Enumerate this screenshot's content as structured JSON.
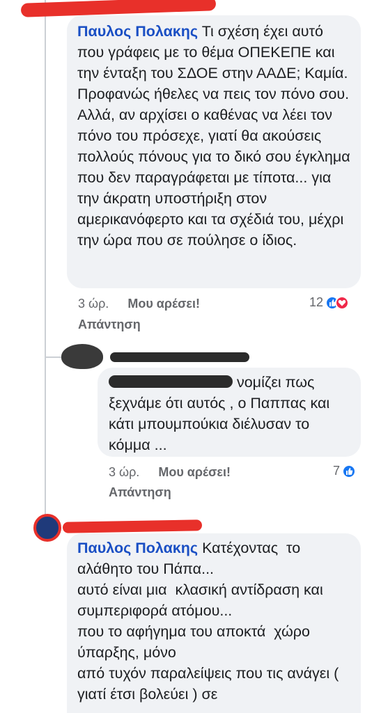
{
  "comments": [
    {
      "mention": "Παυλος Πολακης",
      "text": " Τι σχέση έχει αυτό που γράφεις με το θέμα ΟΠΕΚΕΠΕ και την ένταξη του ΣΔΟΕ στην ΑΑΔΕ; Καμία. Προφανώς ήθελες να πεις τον πόνο σου. Αλλά, αν αρχίσει ο καθένας να λέει τον πόνο του πρόσεχε, γιατί θα ακούσεις πολλούς πόνους για το δικό σου έγκλημα που δεν παραγράφεται με τίποτα... για την άκρατη υποστήριξη στον αμερικανόφερτο και τα σχέδιά του, μέχρι την ώρα που σε πούλησε ο ίδιος.",
      "time": "3 ώρ.",
      "like_label": "Μου αρέσει!",
      "reply_label": "Απάντηση",
      "reaction_count": "12"
    },
    {
      "text": " νομίζει πως ξεχνάμε ότι αυτός , ο Παππας και κάτι μπουμπούκια διέλυσαν το κόμμα ...",
      "time": "3 ώρ.",
      "like_label": "Μου αρέσει!",
      "reply_label": "Απάντηση",
      "reaction_count": "7"
    },
    {
      "mention": "Παυλος Πολακης",
      "text": " Κατέχοντας  το αλάθητο του Πάπα...\nαυτό είναι μια  κλασική αντίδραση και συμπεριφορά ατόμου...\nπου το αφήγημα του αποκτά  χώρο ύπαρξης, μόνο\nαπό τυχόν παραλείψεις που τις ανάγει ( γιατί έτσι βολεύει ) σε"
    }
  ],
  "colors": {
    "mention": "#1a4fc4",
    "bubble": "#f0f2f5",
    "like": "#1877f2",
    "love": "#f02849",
    "redaction_red": "#e8302a"
  },
  "icons": [
    "like-reaction-icon",
    "love-reaction-icon"
  ]
}
